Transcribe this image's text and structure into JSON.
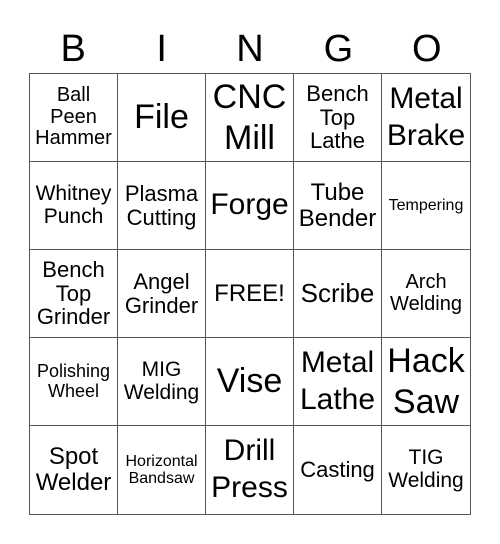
{
  "header": {
    "letters": [
      "B",
      "I",
      "N",
      "G",
      "O"
    ]
  },
  "cells": [
    {
      "text": "Ball\nPeen\nHammer",
      "size": "s20"
    },
    {
      "text": "File",
      "size": "s34"
    },
    {
      "text": "CNC\nMill",
      "size": "s34"
    },
    {
      "text": "Bench\nTop\nLathe",
      "size": "s22"
    },
    {
      "text": "Metal\nBrake",
      "size": "s30"
    },
    {
      "text": "Whitney\nPunch",
      "size": "s21"
    },
    {
      "text": "Plasma\nCutting",
      "size": "s22"
    },
    {
      "text": "Forge",
      "size": "s30"
    },
    {
      "text": "Tube\nBender",
      "size": "s24"
    },
    {
      "text": "Tempering",
      "size": "s16"
    },
    {
      "text": "Bench\nTop\nGrinder",
      "size": "s22"
    },
    {
      "text": "Angel\nGrinder",
      "size": "s22"
    },
    {
      "text": "FREE!",
      "size": "s24"
    },
    {
      "text": "Scribe",
      "size": "s26"
    },
    {
      "text": "Arch\nWelding",
      "size": "s20"
    },
    {
      "text": "Polishing\nWheel",
      "size": "s18"
    },
    {
      "text": "MIG\nWelding",
      "size": "s21"
    },
    {
      "text": "Vise",
      "size": "s34"
    },
    {
      "text": "Metal\nLathe",
      "size": "s30"
    },
    {
      "text": "Hack\nSaw",
      "size": "s34"
    },
    {
      "text": "Spot\nWelder",
      "size": "s24"
    },
    {
      "text": "Horizontal\nBandsaw",
      "size": "s16"
    },
    {
      "text": "Drill\nPress",
      "size": "s30"
    },
    {
      "text": "Casting",
      "size": "s22"
    },
    {
      "text": "TIG\nWelding",
      "size": "s21"
    }
  ]
}
